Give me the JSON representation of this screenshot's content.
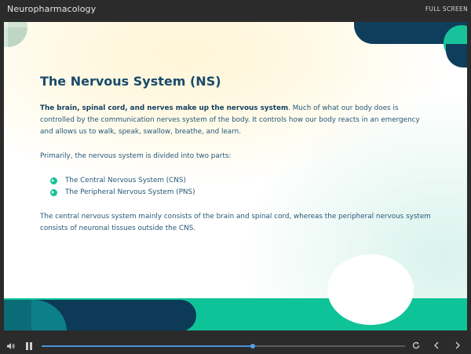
{
  "app": {
    "title": "Neuropharmacology",
    "fullscreen_label": "FULL SCREEN"
  },
  "slide": {
    "heading": "The Nervous System (NS)",
    "intro_bold": "The brain, spinal cord, and nerves make up the nervous system",
    "intro_rest": ". Much of what our body does is controlled by the communication nerves system of the body. It controls how our body reacts in an emergency and allows us to walk, speak, swallow, breathe, and learn.",
    "primarily": "Primarily, the nervous system is divided into two parts:",
    "parts": [
      "The Central Nervous System (CNS)",
      "The Peripheral Nervous System (PNS)"
    ],
    "closing": "The central nervous system mainly consists of the brain and spinal cord, whereas the peripheral nervous system consists of neuronal tissues outside the CNS."
  },
  "player": {
    "progress": 0.58,
    "icons": [
      "volume-icon",
      "pause-icon",
      "replay-icon",
      "chevron-left-icon",
      "chevron-right-icon"
    ]
  },
  "colors": {
    "accent_green": "#18c39b",
    "navy": "#0f3e5c",
    "heading": "#1a4a6c",
    "progress": "#4a90d9"
  }
}
